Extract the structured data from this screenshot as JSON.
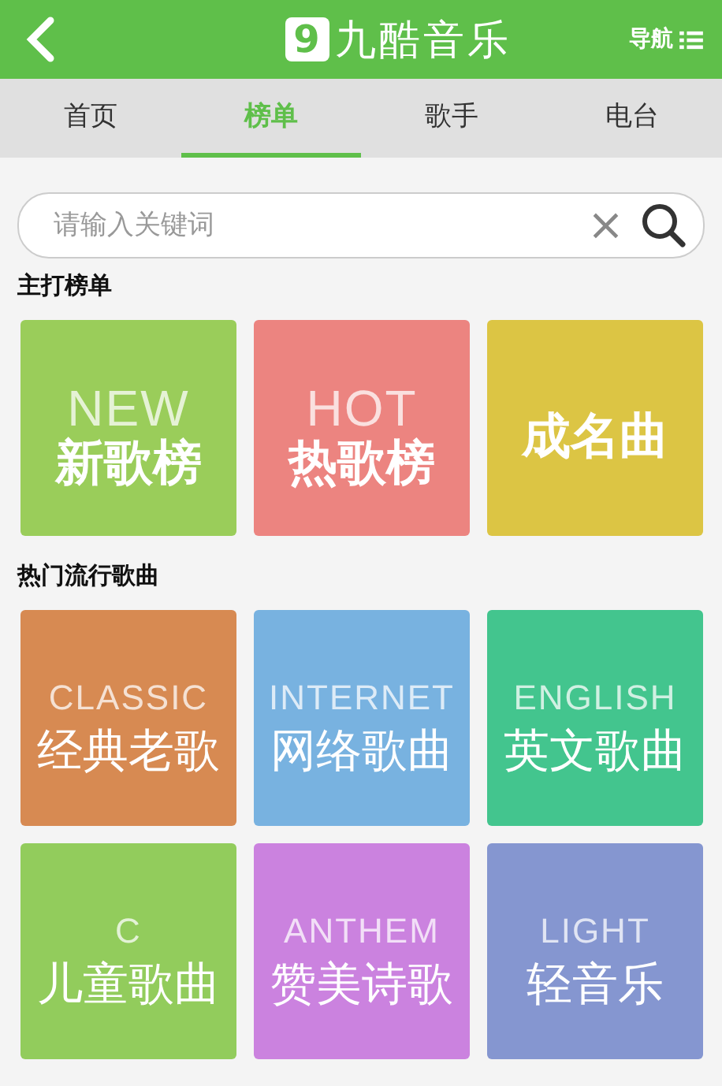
{
  "header": {
    "logo_mark": "9",
    "title": "九酷音乐",
    "nav": "导航"
  },
  "tabs": [
    {
      "label": "首页",
      "selected": false
    },
    {
      "label": "榜单",
      "selected": true
    },
    {
      "label": "歌手",
      "selected": false
    },
    {
      "label": "电台",
      "selected": false
    }
  ],
  "search": {
    "placeholder": "请输入关键词",
    "clear": "×"
  },
  "sections": [
    {
      "title": "主打榜单",
      "kind": "charts",
      "tiles": [
        {
          "subtitle": "NEW",
          "title": "新歌榜",
          "color": "#9acd5a"
        },
        {
          "title": "热歌榜",
          "subtitle": "HOT",
          "color": "#ec8480"
        },
        {
          "title": "成名曲",
          "color": "#dcc544"
        }
      ]
    },
    {
      "title": "热门流行歌曲",
      "kind": "genres",
      "tiles": [
        {
          "subtitle": "CLASSIC",
          "title": "经典老歌",
          "color": "#d78a52"
        },
        {
          "subtitle": "INTERNET",
          "title": "网络歌曲",
          "color": "#78b2e0"
        },
        {
          "subtitle": "ENGLISH",
          "title": "英文歌曲",
          "color": "#43c58e"
        },
        {
          "subtitle": "C",
          "title": "儿童歌曲",
          "color": "#92cc5c"
        },
        {
          "subtitle": "ANTHEM",
          "title": "赞美诗歌",
          "color": "#cb82df"
        },
        {
          "subtitle": "LIGHT",
          "title": "轻音乐",
          "color": "#8596d0"
        }
      ]
    }
  ]
}
